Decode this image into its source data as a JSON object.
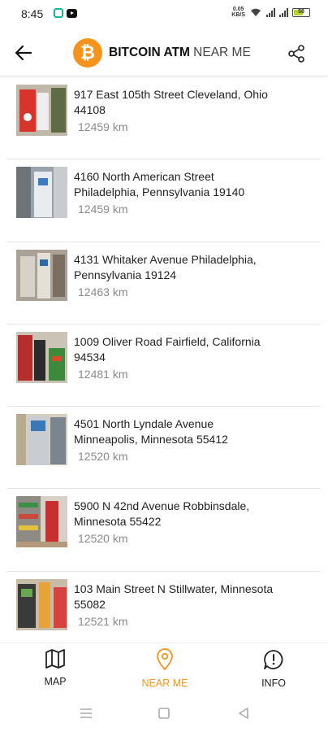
{
  "status_bar": {
    "time": "8:45",
    "speed_top": "0.05",
    "speed_bottom": "KB/S",
    "battery": "58"
  },
  "header": {
    "title_bold": "BITCOIN ATM",
    "title_light": " NEAR ME",
    "logo_symbol": "₿",
    "back_icon": "arrow-left-icon",
    "share_icon": "share-icon"
  },
  "colors": {
    "accent": "#f7931a",
    "distance": "#8a8a8a",
    "divider": "#e4e4e4"
  },
  "locations": [
    {
      "address": "917 East 105th Street Cleveland, Ohio 44108",
      "distance": "12459 km"
    },
    {
      "address": "4160 North American Street Philadelphia, Pennsylvania 19140",
      "distance": "12459 km"
    },
    {
      "address": "4131 Whitaker Avenue Philadelphia, Pennsylvania 19124",
      "distance": "12463 km"
    },
    {
      "address": "1009 Oliver Road Fairfield, California 94534",
      "distance": "12481 km"
    },
    {
      "address": "4501 North Lyndale Avenue Minneapolis, Minnesota  55412",
      "distance": "12520 km"
    },
    {
      "address": "5900 N 42nd Avenue Robbinsdale, Minnesota 55422",
      "distance": "12520 km"
    },
    {
      "address": "103 Main Street N Stillwater, Minnesota 55082",
      "distance": "12521 km"
    }
  ],
  "bottom_nav": [
    {
      "label": "MAP",
      "icon": "map-icon",
      "active": false
    },
    {
      "label": "NEAR ME",
      "icon": "location-pin-icon",
      "active": true
    },
    {
      "label": "INFO",
      "icon": "info-icon",
      "active": false
    }
  ]
}
